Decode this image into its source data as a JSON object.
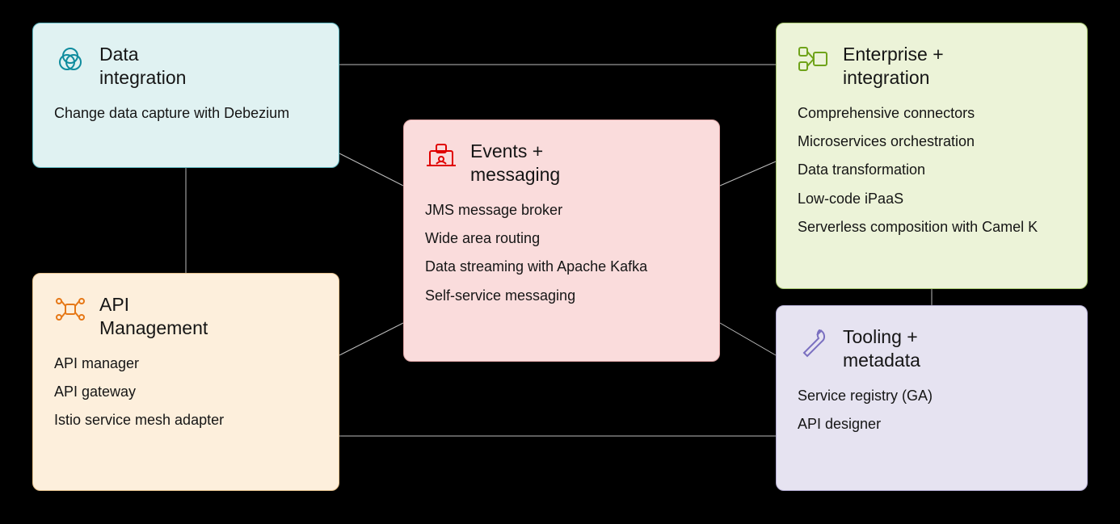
{
  "cards": {
    "data_integration": {
      "title": "Data\nintegration",
      "items": [
        "Change data capture with Debezium"
      ]
    },
    "events_messaging": {
      "title": "Events +\nmessaging",
      "items": [
        "JMS message broker",
        "Wide area routing",
        "Data streaming with Apache Kafka",
        "Self-service messaging"
      ]
    },
    "enterprise_integration": {
      "title": "Enterprise +\nintegration",
      "items": [
        "Comprehensive connectors",
        "Microservices orchestration",
        "Data transformation",
        "Low-code iPaaS",
        "Serverless composition with Camel K"
      ]
    },
    "api_management": {
      "title": "API\nManagement",
      "items": [
        "API manager",
        "API gateway",
        "Istio service mesh adapter"
      ]
    },
    "tooling_metadata": {
      "title": "Tooling +\nmetadata",
      "items": [
        "Service registry (GA)",
        "API designer"
      ]
    }
  },
  "connections": [
    [
      "data_integration",
      "events_messaging"
    ],
    [
      "data_integration",
      "enterprise_integration"
    ],
    [
      "data_integration",
      "api_management"
    ],
    [
      "events_messaging",
      "enterprise_integration"
    ],
    [
      "events_messaging",
      "api_management"
    ],
    [
      "events_messaging",
      "tooling_metadata"
    ],
    [
      "api_management",
      "tooling_metadata"
    ],
    [
      "enterprise_integration",
      "tooling_metadata"
    ]
  ]
}
